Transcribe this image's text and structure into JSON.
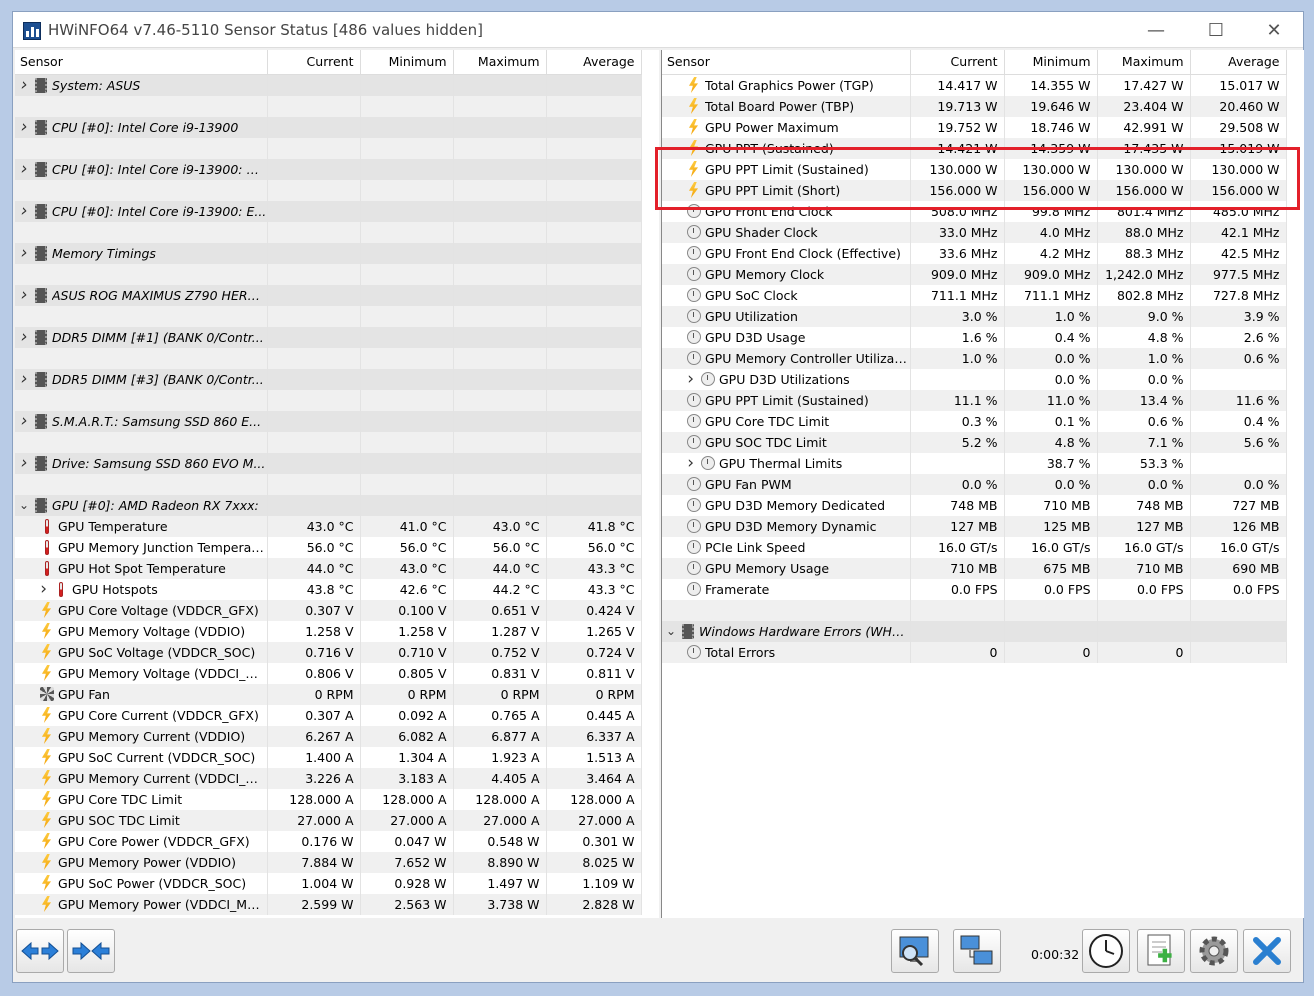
{
  "window": {
    "title": "HWiNFO64 v7.46-5110 Sensor Status [486 values hidden]",
    "minimize": "—",
    "maximize": "☐",
    "close": "✕"
  },
  "columns": [
    "Sensor",
    "Current",
    "Minimum",
    "Maximum",
    "Average"
  ],
  "left_rows": [
    {
      "t": "group",
      "name": "System: ASUS",
      "exp": "collapsed"
    },
    {
      "t": "blank"
    },
    {
      "t": "group",
      "name": "CPU [#0]: Intel Core i9-13900",
      "exp": "collapsed"
    },
    {
      "t": "blank"
    },
    {
      "t": "group",
      "name": "CPU [#0]: Intel Core i9-13900: D...",
      "exp": "collapsed"
    },
    {
      "t": "blank"
    },
    {
      "t": "group",
      "name": "CPU [#0]: Intel Core i9-13900: E...",
      "exp": "collapsed"
    },
    {
      "t": "blank"
    },
    {
      "t": "group",
      "name": "Memory Timings",
      "exp": "collapsed"
    },
    {
      "t": "blank"
    },
    {
      "t": "group",
      "name": "ASUS ROG MAXIMUS Z790 HERO...",
      "exp": "collapsed"
    },
    {
      "t": "blank"
    },
    {
      "t": "group",
      "name": "DDR5 DIMM [#1] (BANK 0/Contr...",
      "exp": "collapsed"
    },
    {
      "t": "blank"
    },
    {
      "t": "group",
      "name": "DDR5 DIMM [#3] (BANK 0/Contr...",
      "exp": "collapsed"
    },
    {
      "t": "blank"
    },
    {
      "t": "group",
      "name": "S.M.A.R.T.: Samsung SSD 860 E...",
      "exp": "collapsed"
    },
    {
      "t": "blank"
    },
    {
      "t": "group",
      "name": "Drive: Samsung SSD 860 EVO M...",
      "exp": "collapsed"
    },
    {
      "t": "blank"
    },
    {
      "t": "group",
      "name": "GPU [#0]: AMD Radeon RX 7xxx:",
      "exp": "expanded"
    },
    {
      "icon": "thermometer-icon",
      "name": "GPU Temperature",
      "v": [
        "43.0 °C",
        "41.0 °C",
        "43.0 °C",
        "41.8 °C"
      ]
    },
    {
      "icon": "thermometer-icon",
      "name": "GPU Memory Junction Temperat...",
      "v": [
        "56.0 °C",
        "56.0 °C",
        "56.0 °C",
        "56.0 °C"
      ]
    },
    {
      "icon": "thermometer-icon",
      "name": "GPU Hot Spot Temperature",
      "v": [
        "44.0 °C",
        "43.0 °C",
        "44.0 °C",
        "43.3 °C"
      ]
    },
    {
      "icon": "thermometer-icon",
      "name": "GPU Hotspots",
      "sub": true,
      "v": [
        "43.8 °C",
        "42.6 °C",
        "44.2 °C",
        "43.3 °C"
      ]
    },
    {
      "icon": "bolt-icon",
      "name": "GPU Core Voltage (VDDCR_GFX)",
      "v": [
        "0.307 V",
        "0.100 V",
        "0.651 V",
        "0.424 V"
      ]
    },
    {
      "icon": "bolt-icon",
      "name": "GPU Memory Voltage (VDDIO)",
      "v": [
        "1.258 V",
        "1.258 V",
        "1.287 V",
        "1.265 V"
      ]
    },
    {
      "icon": "bolt-icon",
      "name": "GPU SoC Voltage (VDDCR_SOC)",
      "v": [
        "0.716 V",
        "0.710 V",
        "0.752 V",
        "0.724 V"
      ]
    },
    {
      "icon": "bolt-icon",
      "name": "GPU Memory Voltage (VDDCI_ME...",
      "v": [
        "0.806 V",
        "0.805 V",
        "0.831 V",
        "0.811 V"
      ]
    },
    {
      "icon": "fan-icon",
      "name": "GPU Fan",
      "v": [
        "0 RPM",
        "0 RPM",
        "0 RPM",
        "0 RPM"
      ]
    },
    {
      "icon": "bolt-icon",
      "name": "GPU Core Current (VDDCR_GFX)",
      "v": [
        "0.307 A",
        "0.092 A",
        "0.765 A",
        "0.445 A"
      ]
    },
    {
      "icon": "bolt-icon",
      "name": "GPU Memory Current (VDDIO)",
      "v": [
        "6.267 A",
        "6.082 A",
        "6.877 A",
        "6.337 A"
      ]
    },
    {
      "icon": "bolt-icon",
      "name": "GPU SoC Current (VDDCR_SOC)",
      "v": [
        "1.400 A",
        "1.304 A",
        "1.923 A",
        "1.513 A"
      ]
    },
    {
      "icon": "bolt-icon",
      "name": "GPU Memory Current (VDDCI_ME...",
      "v": [
        "3.226 A",
        "3.183 A",
        "4.405 A",
        "3.464 A"
      ]
    },
    {
      "icon": "bolt-icon",
      "name": "GPU Core TDC Limit",
      "v": [
        "128.000 A",
        "128.000 A",
        "128.000 A",
        "128.000 A"
      ]
    },
    {
      "icon": "bolt-icon",
      "name": "GPU SOC TDC Limit",
      "v": [
        "27.000 A",
        "27.000 A",
        "27.000 A",
        "27.000 A"
      ]
    },
    {
      "icon": "bolt-icon",
      "name": "GPU Core Power (VDDCR_GFX)",
      "v": [
        "0.176 W",
        "0.047 W",
        "0.548 W",
        "0.301 W"
      ]
    },
    {
      "icon": "bolt-icon",
      "name": "GPU Memory Power (VDDIO)",
      "v": [
        "7.884 W",
        "7.652 W",
        "8.890 W",
        "8.025 W"
      ]
    },
    {
      "icon": "bolt-icon",
      "name": "GPU SoC Power (VDDCR_SOC)",
      "v": [
        "1.004 W",
        "0.928 W",
        "1.497 W",
        "1.109 W"
      ]
    },
    {
      "icon": "bolt-icon",
      "name": "GPU Memory Power (VDDCI_MEM)",
      "v": [
        "2.599 W",
        "2.563 W",
        "3.738 W",
        "2.828 W"
      ]
    }
  ],
  "right_rows": [
    {
      "icon": "bolt-icon",
      "name": "Total Graphics Power (TGP)",
      "v": [
        "14.417 W",
        "14.355 W",
        "17.427 W",
        "15.017 W"
      ]
    },
    {
      "icon": "bolt-icon",
      "name": "Total Board Power (TBP)",
      "v": [
        "19.713 W",
        "19.646 W",
        "23.404 W",
        "20.460 W"
      ]
    },
    {
      "icon": "bolt-icon",
      "name": "GPU Power Maximum",
      "v": [
        "19.752 W",
        "18.746 W",
        "42.991 W",
        "29.508 W"
      ]
    },
    {
      "icon": "bolt-icon",
      "name": "GPU PPT (Sustained)",
      "v": [
        "14.421 W",
        "14.359 W",
        "17.435 W",
        "15.019 W"
      ]
    },
    {
      "icon": "bolt-icon",
      "name": "GPU PPT Limit (Sustained)",
      "v": [
        "130.000 W",
        "130.000 W",
        "130.000 W",
        "130.000 W"
      ]
    },
    {
      "icon": "bolt-icon",
      "name": "GPU PPT Limit (Short)",
      "v": [
        "156.000 W",
        "156.000 W",
        "156.000 W",
        "156.000 W"
      ]
    },
    {
      "icon": "clock-icon",
      "name": "GPU Front End Clock",
      "v": [
        "508.0 MHz",
        "99.8 MHz",
        "801.4 MHz",
        "485.0 MHz"
      ]
    },
    {
      "icon": "clock-icon",
      "name": "GPU Shader Clock",
      "v": [
        "33.0 MHz",
        "4.0 MHz",
        "88.0 MHz",
        "42.1 MHz"
      ]
    },
    {
      "icon": "clock-icon",
      "name": "GPU Front End Clock (Effective)",
      "v": [
        "33.6 MHz",
        "4.2 MHz",
        "88.3 MHz",
        "42.5 MHz"
      ]
    },
    {
      "icon": "clock-icon",
      "name": "GPU Memory Clock",
      "v": [
        "909.0 MHz",
        "909.0 MHz",
        "1,242.0 MHz",
        "977.5 MHz"
      ]
    },
    {
      "icon": "clock-icon",
      "name": "GPU SoC Clock",
      "v": [
        "711.1 MHz",
        "711.1 MHz",
        "802.8 MHz",
        "727.8 MHz"
      ]
    },
    {
      "icon": "clock-icon",
      "name": "GPU Utilization",
      "v": [
        "3.0 %",
        "1.0 %",
        "9.0 %",
        "3.9 %"
      ]
    },
    {
      "icon": "clock-icon",
      "name": "GPU D3D Usage",
      "v": [
        "1.6 %",
        "0.4 %",
        "4.8 %",
        "2.6 %"
      ]
    },
    {
      "icon": "clock-icon",
      "name": "GPU Memory Controller Utilization",
      "v": [
        "1.0 %",
        "0.0 %",
        "1.0 %",
        "0.6 %"
      ]
    },
    {
      "icon": "clock-icon",
      "name": "GPU D3D Utilizations",
      "sub": true,
      "v": [
        "",
        "0.0 %",
        "0.0 %",
        ""
      ]
    },
    {
      "icon": "clock-icon",
      "name": "GPU PPT Limit (Sustained)",
      "v": [
        "11.1 %",
        "11.0 %",
        "13.4 %",
        "11.6 %"
      ]
    },
    {
      "icon": "clock-icon",
      "name": "GPU Core TDC Limit",
      "v": [
        "0.3 %",
        "0.1 %",
        "0.6 %",
        "0.4 %"
      ]
    },
    {
      "icon": "clock-icon",
      "name": "GPU SOC TDC Limit",
      "v": [
        "5.2 %",
        "4.8 %",
        "7.1 %",
        "5.6 %"
      ]
    },
    {
      "icon": "clock-icon",
      "name": "GPU Thermal Limits",
      "sub": true,
      "v": [
        "",
        "38.7 %",
        "53.3 %",
        ""
      ]
    },
    {
      "icon": "clock-icon",
      "name": "GPU Fan PWM",
      "v": [
        "0.0 %",
        "0.0 %",
        "0.0 %",
        "0.0 %"
      ]
    },
    {
      "icon": "clock-icon",
      "name": "GPU D3D Memory Dedicated",
      "v": [
        "748 MB",
        "710 MB",
        "748 MB",
        "727 MB"
      ]
    },
    {
      "icon": "clock-icon",
      "name": "GPU D3D Memory Dynamic",
      "v": [
        "127 MB",
        "125 MB",
        "127 MB",
        "126 MB"
      ]
    },
    {
      "icon": "clock-icon",
      "name": "PCIe Link Speed",
      "v": [
        "16.0 GT/s",
        "16.0 GT/s",
        "16.0 GT/s",
        "16.0 GT/s"
      ]
    },
    {
      "icon": "clock-icon",
      "name": "GPU Memory Usage",
      "v": [
        "710 MB",
        "675 MB",
        "710 MB",
        "690 MB"
      ]
    },
    {
      "icon": "clock-icon",
      "name": "Framerate",
      "v": [
        "0.0 FPS",
        "0.0 FPS",
        "0.0 FPS",
        "0.0 FPS"
      ]
    },
    {
      "t": "blank"
    },
    {
      "t": "group",
      "name": "Windows Hardware Errors (WHEA)",
      "exp": "expanded"
    },
    {
      "icon": "clock-icon",
      "name": "Total Errors",
      "v": [
        "0",
        "0",
        "0",
        ""
      ]
    }
  ],
  "toolbar": {
    "timer": "0:00:32",
    "buttons": [
      "expand-arrows",
      "collapse-arrows",
      "sensor-monitor",
      "network",
      "clock",
      "report",
      "settings",
      "close"
    ]
  },
  "highlight_color": "#e3202a"
}
